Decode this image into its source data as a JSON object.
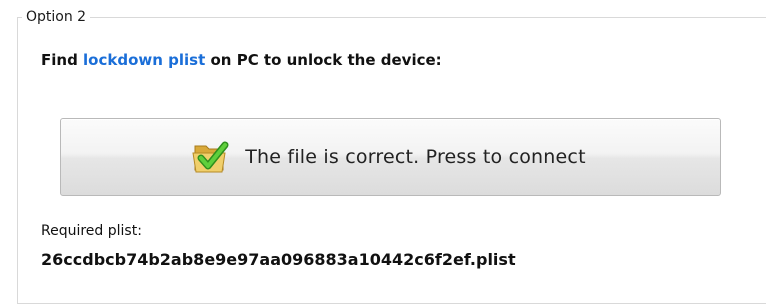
{
  "group": {
    "title": "Option 2"
  },
  "instruction": {
    "prefix": "Find ",
    "link": "lockdown plist",
    "suffix": " on PC to unlock the device:"
  },
  "connect_button": {
    "label": "The file is correct. Press to connect",
    "icon": "folder-checkmark-icon"
  },
  "required": {
    "label": "Required plist:",
    "filename": "26ccdbcb74b2ab8e9e97aa096883a10442c6f2ef.plist"
  },
  "colors": {
    "link": "#1a6ed8",
    "border": "#d9d9d9",
    "check_green": "#3fae2a",
    "folder_yellow": "#e8c25a"
  }
}
